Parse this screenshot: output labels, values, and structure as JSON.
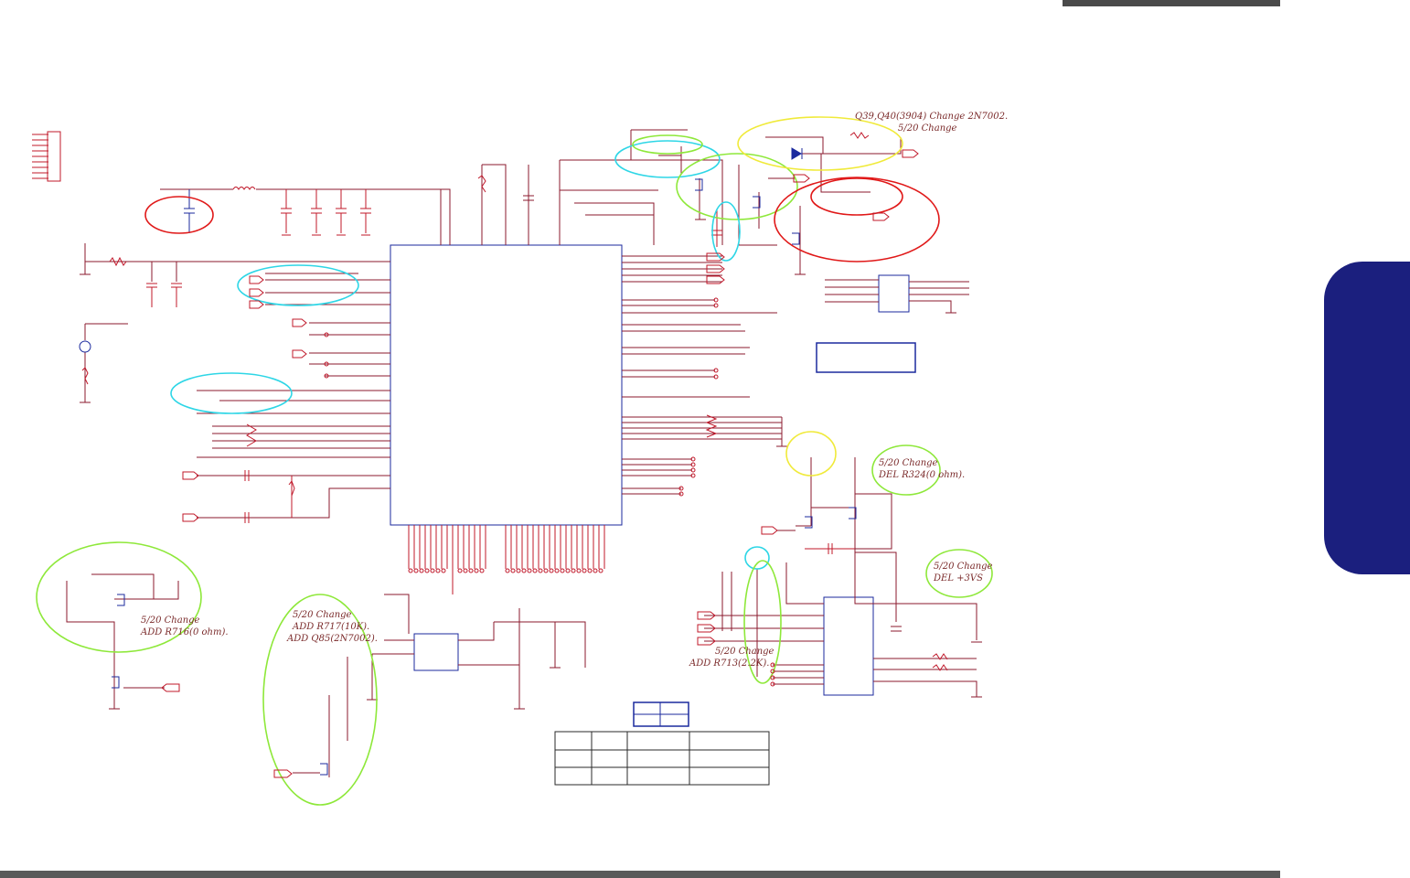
{
  "notes": {
    "q39": "Q39,Q40(3904) Change 2N7002.",
    "q39_date": "5/20 Change",
    "r324_a": "5/20 Change",
    "r324_b": "DEL R324(0 ohm).",
    "p3vs_a": "5/20 Change",
    "p3vs_b": "DEL +3VS",
    "r713_a": "5/20 Change",
    "r713_b": "ADD R713(2.2K).",
    "r716_a": "5/20 Change",
    "r716_b": "ADD R716(0 ohm).",
    "r717_a": "5/20 Change",
    "r717_b": "ADD R717(10K).",
    "r717_c": "ADD Q85(2N7002)."
  },
  "colors": {
    "wire": "#8b1a2e",
    "part": "#c0182a",
    "blue": "#1b2a9e",
    "cyan": "#2ed6e6",
    "green": "#8ee83a",
    "yellow": "#f0ea3a",
    "red": "#e01818",
    "tab": "#1b1f7e"
  }
}
